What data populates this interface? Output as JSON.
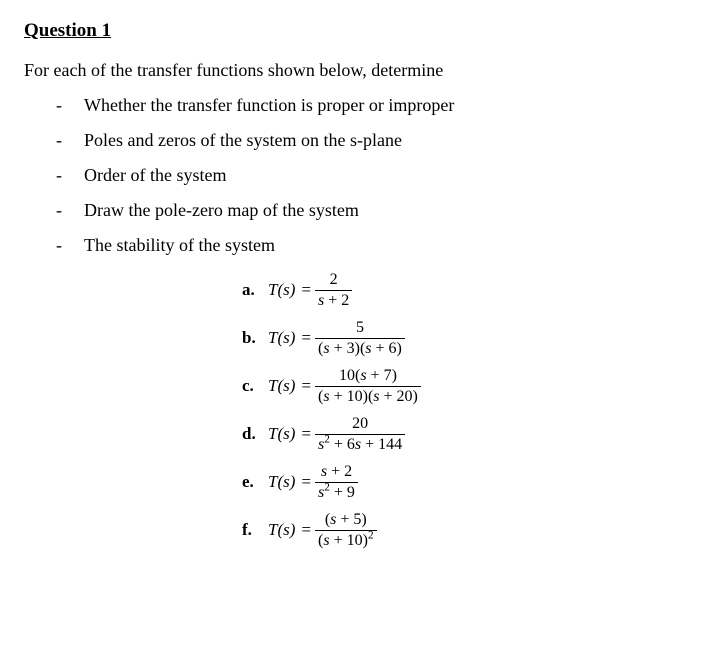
{
  "title": "Question 1",
  "intro": "For each of the transfer functions shown below, determine",
  "bullets": [
    "Whether the transfer function is proper or improper",
    "Poles and zeros of the system on the s-plane",
    "Order of the system",
    "Draw the pole-zero map of the system",
    "The stability of the system"
  ],
  "lhs": "T(s)",
  "eq_symbol": "=",
  "items": [
    {
      "label": "a.",
      "numerator": "2",
      "denominator": "s + 2"
    },
    {
      "label": "b.",
      "numerator": "5",
      "denominator": "(s + 3)(s + 6)"
    },
    {
      "label": "c.",
      "numerator": "10(s + 7)",
      "denominator": "(s + 10)(s + 20)"
    },
    {
      "label": "d.",
      "numerator": "20",
      "denominator": "s^2 + 6s + 144"
    },
    {
      "label": "e.",
      "numerator": "s + 2",
      "denominator": "s^2 + 9"
    },
    {
      "label": "f.",
      "numerator": "(s + 5)",
      "denominator": "(s + 10)^2"
    }
  ]
}
